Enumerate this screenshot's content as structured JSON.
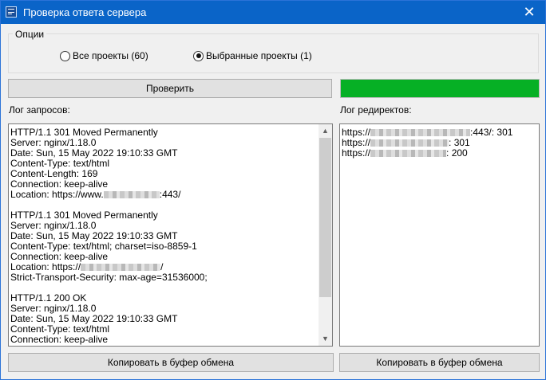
{
  "window": {
    "title": "Проверка ответа сервера",
    "close_glyph": "✕"
  },
  "options": {
    "legend": "Опции",
    "radio_all": {
      "label": "Все проекты (60)",
      "checked": false
    },
    "radio_selected": {
      "label": "Выбранные проекты (1)",
      "checked": true
    }
  },
  "check_button": {
    "label": "Проверить"
  },
  "progress": {
    "value_percent": 100,
    "color": "#06b025"
  },
  "request_log": {
    "label": "Лог запросов:",
    "lines": [
      "HTTP/1.1 301 Moved Permanently",
      "Server: nginx/1.18.0",
      "Date: Sun, 15 May 2022 19:10:33 GMT",
      "Content-Type: text/html",
      "Content-Length: 169",
      "Connection: keep-alive",
      "Location: https://www.",
      "",
      "HTTP/1.1 301 Moved Permanently",
      "Server: nginx/1.18.0",
      "Date: Sun, 15 May 2022 19:10:33 GMT",
      "Content-Type: text/html; charset=iso-8859-1",
      "Connection: keep-alive",
      "Location: https://",
      "Strict-Transport-Security: max-age=31536000;",
      "",
      "HTTP/1.1 200 OK",
      "Server: nginx/1.18.0",
      "Date: Sun, 15 May 2022 19:10:33 GMT",
      "Content-Type: text/html",
      "Connection: keep-alive"
    ],
    "location_1_suffix": ":443/",
    "location_2_suffix": "/"
  },
  "redirect_log": {
    "label": "Лог редиректов:",
    "lines": [
      {
        "prefix": "https://",
        "suffix": ":443/: 301"
      },
      {
        "prefix": "https://",
        "suffix": ": 301"
      },
      {
        "prefix": "https://",
        "suffix": ": 200"
      }
    ]
  },
  "copy_button_left": {
    "label": "Копировать в буфер обмена"
  },
  "copy_button_right": {
    "label": "Копировать в буфер обмена"
  },
  "icons": {
    "app": "server-check-icon",
    "close": "close-icon",
    "scroll_up": "▲",
    "scroll_down": "▼"
  }
}
